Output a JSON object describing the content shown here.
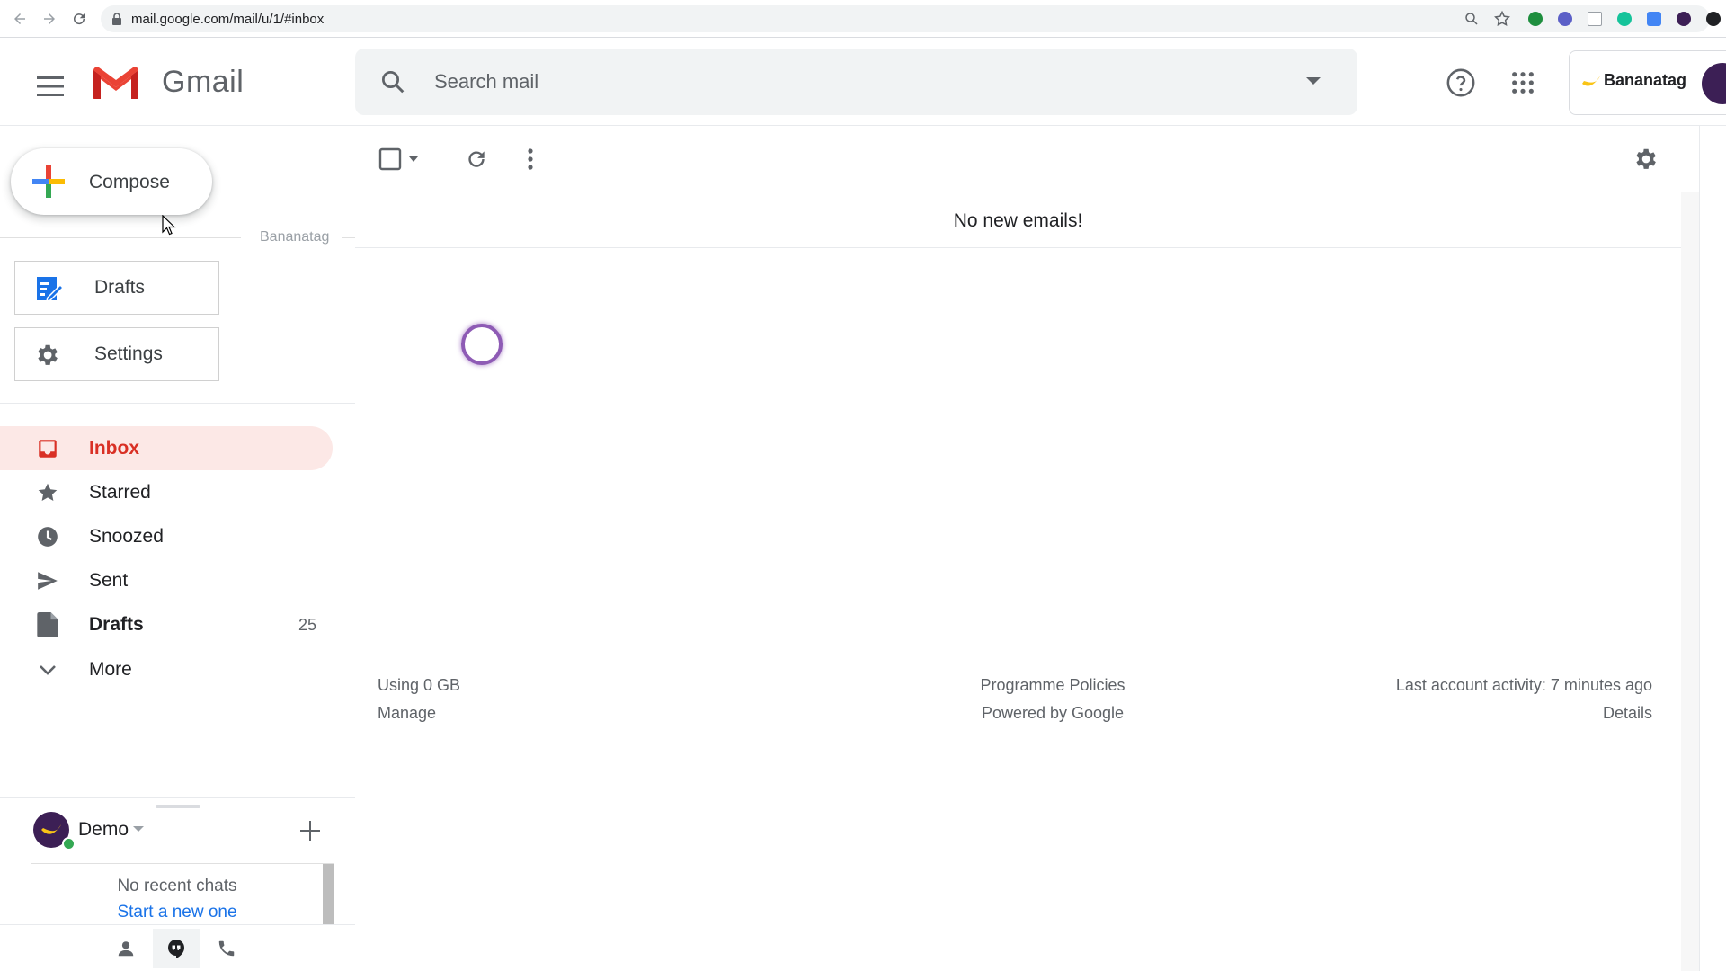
{
  "browser": {
    "url": "mail.google.com/mail/u/1/#inbox",
    "extensions": [
      "zoom-icon",
      "bookmark-star-icon",
      "check-extension-icon",
      "purple-extension-icon",
      "page-extension-icon",
      "grammarly-icon",
      "blue-extension-icon",
      "bananatag-extension-icon",
      "profile-icon"
    ]
  },
  "header": {
    "app_name": "Gmail",
    "search_placeholder": "Search mail",
    "bananatag_label": "Bananatag"
  },
  "sidebar": {
    "compose_label": "Compose",
    "bananatag_section": "Bananatag",
    "bananatag_items": [
      {
        "label": "Drafts",
        "icon": "drafts-edit-icon"
      },
      {
        "label": "Settings",
        "icon": "gear-icon"
      }
    ],
    "nav": [
      {
        "label": "Inbox",
        "icon": "inbox-icon",
        "active": true,
        "count": ""
      },
      {
        "label": "Starred",
        "icon": "star-icon",
        "active": false,
        "count": ""
      },
      {
        "label": "Snoozed",
        "icon": "clock-icon",
        "active": false,
        "count": ""
      },
      {
        "label": "Sent",
        "icon": "send-icon",
        "active": false,
        "count": ""
      },
      {
        "label": "Drafts",
        "icon": "draft-file-icon",
        "active": false,
        "count": "25"
      },
      {
        "label": "More",
        "icon": "chevron-down-icon",
        "active": false,
        "count": ""
      }
    ]
  },
  "hangouts": {
    "user_name": "Demo",
    "no_recent": "No recent chats",
    "start_new": "Start a new one"
  },
  "main": {
    "empty_message": "No new emails!",
    "footer": {
      "storage": "Using 0 GB",
      "manage": "Manage",
      "policies": "Programme Policies",
      "powered": "Powered by Google",
      "activity": "Last account activity: 7 minutes ago",
      "details": "Details"
    }
  },
  "colors": {
    "active_red": "#d93025",
    "active_bg": "#fce8e6",
    "link_blue": "#1a73e8",
    "bananatag_purple": "#3c1f55"
  }
}
